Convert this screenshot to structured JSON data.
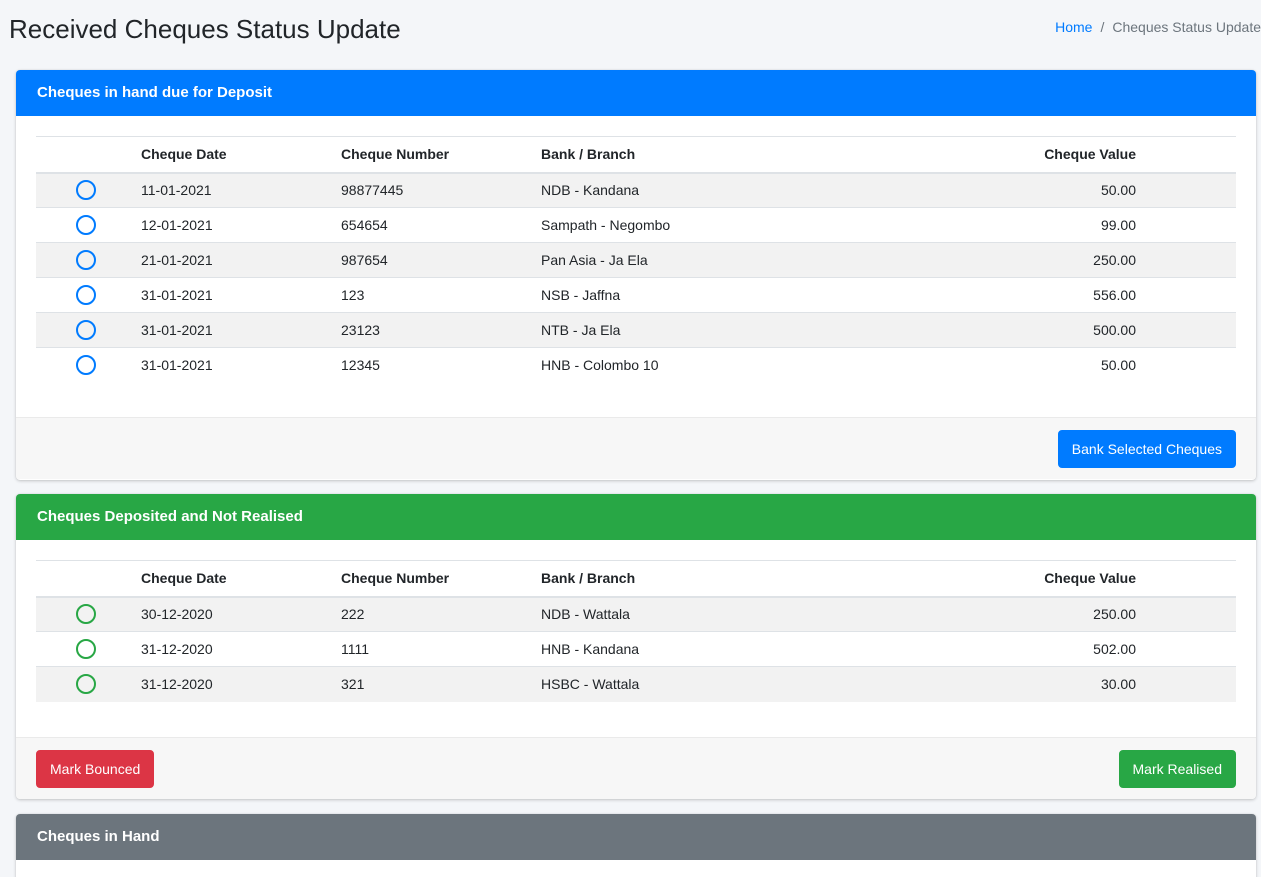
{
  "header": {
    "title": "Received Cheques Status Update",
    "breadcrumb": {
      "home": "Home",
      "separator": "/",
      "current": "Cheques Status Update"
    }
  },
  "columns": {
    "date": "Cheque Date",
    "number": "Cheque Number",
    "bank": "Bank / Branch",
    "value": "Cheque Value"
  },
  "deposit_due": {
    "title": "Cheques in hand due for Deposit",
    "color": "#007bff",
    "rows": [
      {
        "date": "11-01-2021",
        "number": "98877445",
        "bank": "NDB - Kandana",
        "value": "50.00"
      },
      {
        "date": "12-01-2021",
        "number": "654654",
        "bank": "Sampath - Negombo",
        "value": "99.00"
      },
      {
        "date": "21-01-2021",
        "number": "987654",
        "bank": "Pan Asia - Ja Ela",
        "value": "250.00"
      },
      {
        "date": "31-01-2021",
        "number": "123",
        "bank": "NSB - Jaffna",
        "value": "556.00"
      },
      {
        "date": "31-01-2021",
        "number": "23123",
        "bank": "NTB - Ja Ela",
        "value": "500.00"
      },
      {
        "date": "31-01-2021",
        "number": "12345",
        "bank": "HNB - Colombo 10",
        "value": "50.00"
      }
    ],
    "button": "Bank Selected Cheques"
  },
  "deposited": {
    "title": "Cheques Deposited and Not Realised",
    "color": "#28a745",
    "rows": [
      {
        "date": "30-12-2020",
        "number": "222",
        "bank": "NDB - Wattala",
        "value": "250.00"
      },
      {
        "date": "31-12-2020",
        "number": "1111",
        "bank": "HNB - Kandana",
        "value": "502.00"
      },
      {
        "date": "31-12-2020",
        "number": "321",
        "bank": "HSBC - Wattala",
        "value": "30.00"
      }
    ],
    "bounce_button": "Mark Bounced",
    "realise_button": "Mark Realised"
  },
  "in_hand": {
    "title": "Cheques in Hand",
    "color": "#6c757d"
  }
}
